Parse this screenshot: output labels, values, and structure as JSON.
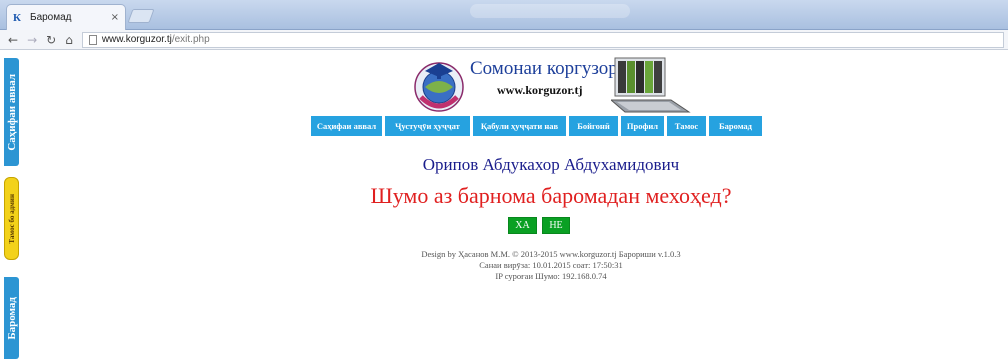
{
  "browser": {
    "tab_title": "Баромад",
    "tab_favicon": "К",
    "tab_close": "×",
    "url_host": "www.korguzor.tj",
    "url_path": "/exit.php"
  },
  "sidebar": {
    "home": "Саҳифаи аввал",
    "contact": "Тамос бо админ",
    "exit": "Баромад"
  },
  "header": {
    "site_name": "Сомонаи коргузорӣ",
    "site_url": "www.korguzor.tj"
  },
  "nav": {
    "items": [
      {
        "label": "Саҳифаи аввал"
      },
      {
        "label": "Ҷустуҷӯи ҳуҷҷат"
      },
      {
        "label": "Қабули ҳуҷҷати нав"
      },
      {
        "label": "Бойгонӣ"
      },
      {
        "label": "Профил"
      },
      {
        "label": "Тамос"
      },
      {
        "label": "Баромад"
      }
    ]
  },
  "main": {
    "user_name": "Орипов Абдукахор Абдухамидович",
    "question": "Шумо аз барнома баромадан мехоҳед?",
    "yes_label": "ХА",
    "no_label": "НЕ"
  },
  "footer": {
    "line1": "Design by Ҳасанов М.М. © 2013-2015 www.korguzor.tj Барориши v.1.0.3",
    "line2": "Санаи вирӯза: 10.01.2015 соат: 17:50:31",
    "line3": "IP суроғаи Шумо: 192.168.0.74"
  },
  "colors": {
    "nav_bg": "#26a2e0",
    "side_tab_bg": "#2c95d3",
    "contact_tab_bg": "#f3d21a",
    "button_bg": "#0aa023",
    "question_color": "#e02020",
    "user_name_color": "#1a1d8c"
  }
}
